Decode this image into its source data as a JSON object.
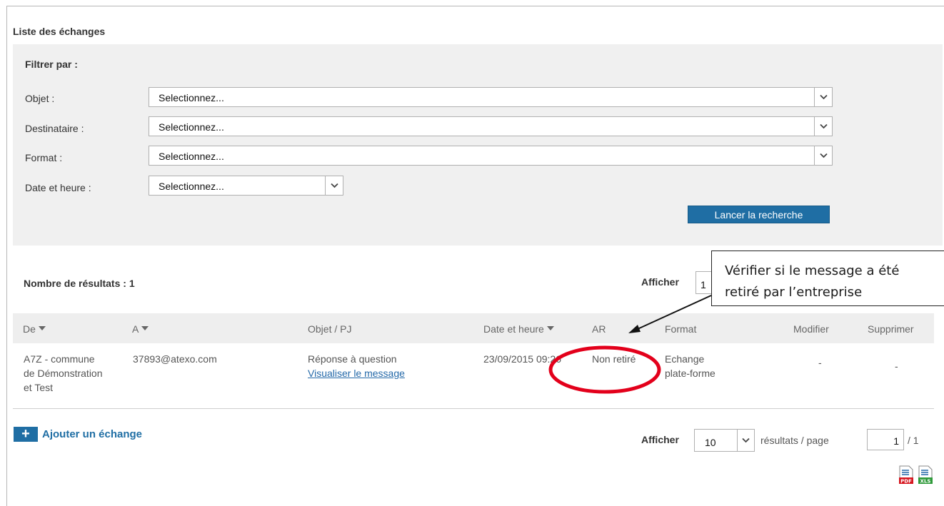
{
  "section_title": "Liste des échanges",
  "filter": {
    "title": "Filtrer par :",
    "fields": [
      {
        "label": "Objet :",
        "value": "Selectionnez..."
      },
      {
        "label": "Destinataire :",
        "value": "Selectionnez..."
      },
      {
        "label": "Format :",
        "value": "Selectionnez..."
      },
      {
        "label": "Date et heure :",
        "value": "Selectionnez..."
      }
    ],
    "search_button": "Lancer la recherche"
  },
  "results": {
    "count_label": "Nombre de résultats : 1",
    "afficher_label": "Afficher",
    "afficher_top_value": "1"
  },
  "callout": {
    "line1": "Vérifier si le message a été",
    "line2": "retiré par l’entreprise"
  },
  "table": {
    "headers": {
      "de": "De",
      "a": "A",
      "objet": "Objet / PJ",
      "date": "Date et heure",
      "ar": "AR",
      "format": "Format",
      "modifier": "Modifier",
      "supprimer": "Supprimer"
    },
    "row": {
      "de_line1": "A7Z - commune",
      "de_line2": "de Démonstration",
      "de_line3": "et Test",
      "a": "37893@atexo.com",
      "objet": "Réponse à question",
      "objet_link": "Visualiser le message",
      "date": "23/09/2015 09:26",
      "ar": "Non retiré",
      "format_line1": "Echange",
      "format_line2": "plate-forme",
      "modifier": "-",
      "supprimer": "-"
    }
  },
  "footer": {
    "add_button": "Ajouter un échange",
    "plus": "+",
    "afficher_label": "Afficher",
    "page_size": "10",
    "per_page_label": "résultats / page",
    "current_page": "1",
    "total_pages": "/ 1",
    "pdf_label": "PDF",
    "xls_label": "XLS"
  },
  "colors": {
    "accent": "#1f6ea4",
    "link": "#2469a9",
    "annotation_red": "#e3001b"
  }
}
